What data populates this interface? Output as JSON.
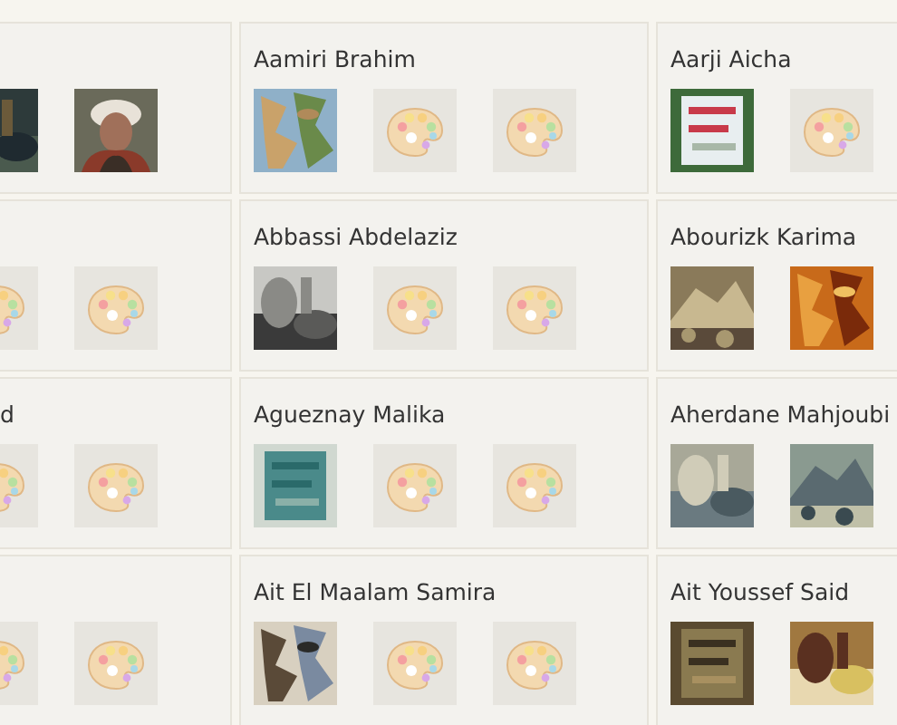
{
  "rows": [
    {
      "cells": [
        {
          "thumbs": [
            {
              "kind": "picture"
            },
            {
              "kind": "picture"
            }
          ]
        },
        {
          "name": "Aamiri Brahim",
          "thumbs": [
            {
              "kind": "picture"
            },
            {
              "kind": "placeholder"
            },
            {
              "kind": "placeholder"
            }
          ]
        },
        {
          "name": "Aarji Aicha",
          "thumbs": [
            {
              "kind": "picture"
            },
            {
              "kind": "placeholder"
            }
          ]
        }
      ]
    },
    {
      "cells": [
        {
          "thumbs": [
            {
              "kind": "placeholder"
            },
            {
              "kind": "placeholder"
            }
          ]
        },
        {
          "name": "Abbassi Abdelaziz",
          "thumbs": [
            {
              "kind": "picture"
            },
            {
              "kind": "placeholder"
            },
            {
              "kind": "placeholder"
            }
          ]
        },
        {
          "name": "Abourizk Karima",
          "thumbs": [
            {
              "kind": "picture"
            },
            {
              "kind": "picture"
            }
          ]
        }
      ]
    },
    {
      "cells": [
        {
          "name": "d",
          "thumbs": [
            {
              "kind": "placeholder"
            },
            {
              "kind": "placeholder"
            }
          ]
        },
        {
          "name": "Agueznay Malika",
          "thumbs": [
            {
              "kind": "picture"
            },
            {
              "kind": "placeholder"
            },
            {
              "kind": "placeholder"
            }
          ]
        },
        {
          "name": "Aherdane Mahjoubi",
          "thumbs": [
            {
              "kind": "picture"
            },
            {
              "kind": "picture"
            }
          ]
        }
      ]
    },
    {
      "cells": [
        {
          "thumbs": [
            {
              "kind": "placeholder"
            },
            {
              "kind": "placeholder"
            }
          ]
        },
        {
          "name": "Ait El Maalam Samira",
          "thumbs": [
            {
              "kind": "picture"
            },
            {
              "kind": "placeholder"
            },
            {
              "kind": "placeholder"
            }
          ]
        },
        {
          "name": "Ait Youssef Said",
          "thumbs": [
            {
              "kind": "picture"
            },
            {
              "kind": "picture"
            }
          ]
        }
      ]
    }
  ]
}
